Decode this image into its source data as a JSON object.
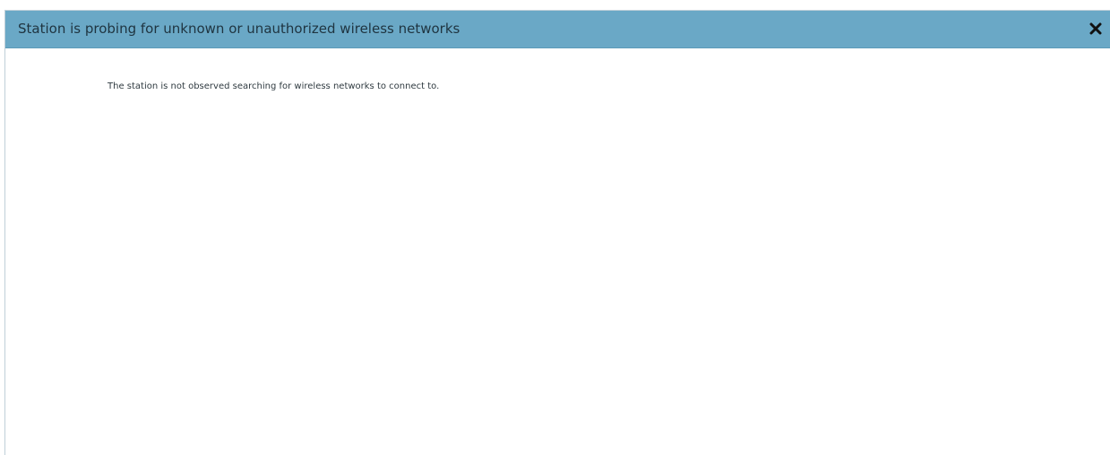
{
  "dialog": {
    "title": "Station is probing for unknown or unauthorized wireless networks",
    "close_icon": "close-icon",
    "message": "The station is not observed searching for wireless networks to connect to."
  },
  "colors": {
    "titlebar": "#6aa8c6",
    "title_text": "#1f3440",
    "body_text": "#2f3a40"
  }
}
